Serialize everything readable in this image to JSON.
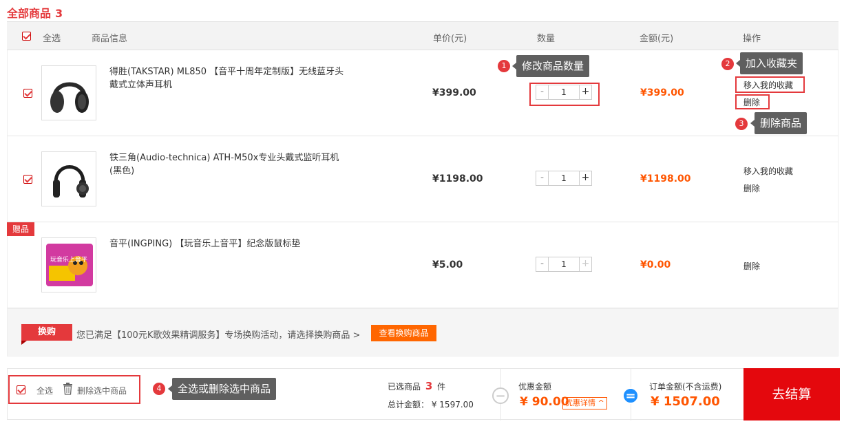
{
  "header": {
    "title": "全部商品",
    "count": "3"
  },
  "columns": {
    "select_all": "全选",
    "info": "商品信息",
    "unit_price": "单价(元)",
    "quantity": "数量",
    "amount": "金额(元)",
    "operation": "操作"
  },
  "items": [
    {
      "name": "得胜(TAKSTAR) ML850 【音平十周年定制版】无线蓝牙头戴式立体声耳机",
      "price": "¥399.00",
      "qty": "1",
      "amount": "¥399.00",
      "op_fav": "移入我的收藏",
      "op_del": "删除"
    },
    {
      "name": "铁三角(Audio-technica) ATH-M50x专业头戴式监听耳机 (黑色)",
      "price": "¥1198.00",
      "qty": "1",
      "amount": "¥1198.00",
      "op_fav": "移入我的收藏",
      "op_del": "删除"
    },
    {
      "name": "音平(INGPING) 【玩音乐上音平】纪念版鼠标垫",
      "price": "¥5.00",
      "qty": "1",
      "amount": "¥0.00",
      "op_del": "删除",
      "badge": "赠品",
      "thumb_text": "玩音乐上音平"
    }
  ],
  "qty_minus": "-",
  "qty_plus": "+",
  "swap": {
    "tag": "换购",
    "text": "您已满足【100元K歌效果精调服务】专场换购活动，请选择换购商品 >",
    "button": "查看换购商品"
  },
  "footer": {
    "select_all": "全选",
    "delete_selected": "删除选中商品",
    "selected_label": "已选商品",
    "selected_count": "3",
    "selected_unit": "件",
    "total_label": "总计金额：",
    "total_value": "¥ 1597.00",
    "minus_sign": "−",
    "discount_label": "优惠金额",
    "discount_value": "¥ 90.00",
    "discount_detail": "优惠详情 ^",
    "equals_sign": "=",
    "order_label": "订单金额(不含运费)",
    "order_value": "¥ 1507.00",
    "checkout": "去结算"
  },
  "callouts": [
    {
      "num": "1",
      "text": "修改商品数量"
    },
    {
      "num": "2",
      "text": "加入收藏夹"
    },
    {
      "num": "3",
      "text": "删除商品"
    },
    {
      "num": "4",
      "text": "全选或删除选中商品"
    }
  ],
  "colors": {
    "accent": "#e4393c",
    "amount": "#ff5500",
    "checkout": "#e4080d",
    "callout_bg": "#5f5f5f",
    "discount_icon": "#cccccc",
    "equals_icon": "#1e90ff"
  }
}
